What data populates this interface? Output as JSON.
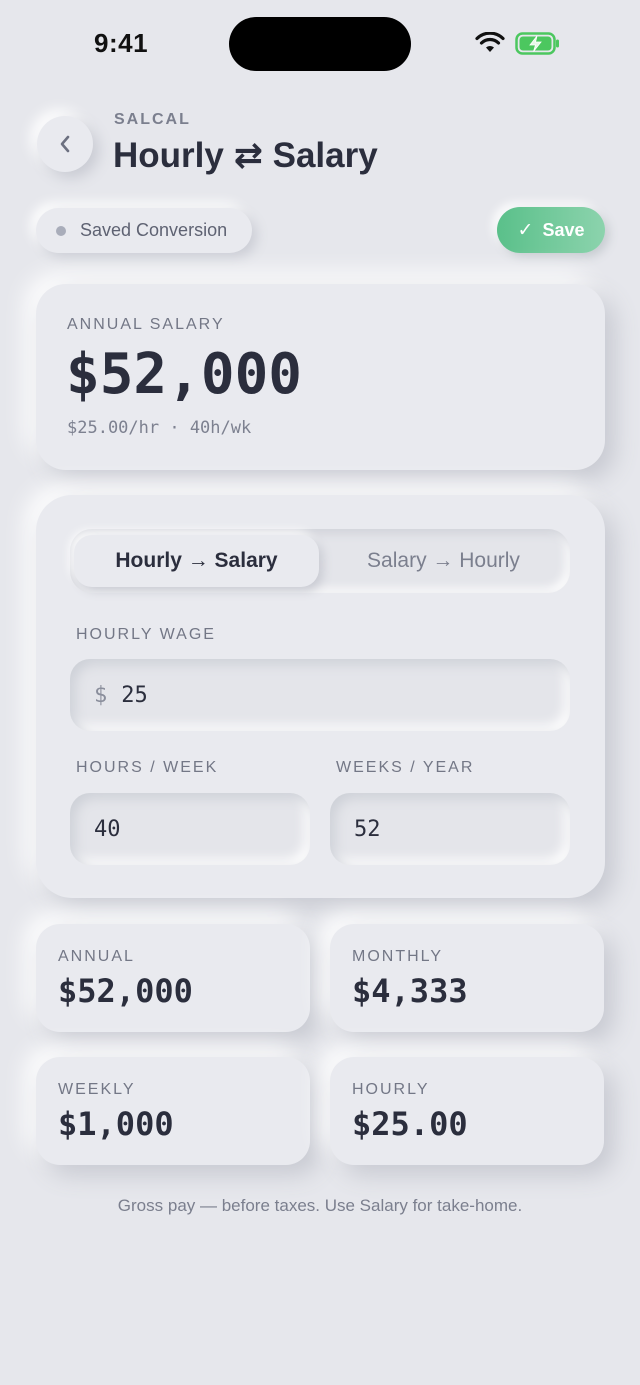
{
  "status_bar": {
    "time": "9:41"
  },
  "header": {
    "eyebrow": "SALCAL",
    "title": "Hourly ⇄ Salary",
    "back_icon": "chevron-left-icon"
  },
  "saved_pill": {
    "label": "Saved Conversion"
  },
  "save_button": {
    "label": "Save",
    "icon": "check-icon"
  },
  "hero": {
    "label": "ANNUAL SALARY",
    "value": "$52,000",
    "subtitle": "$25.00/hr · 40h/wk"
  },
  "mode_toggle": {
    "options": [
      "Hourly → Salary",
      "Salary → Hourly"
    ],
    "selected": "Hourly → Salary"
  },
  "inputs": {
    "hourly_wage": {
      "label": "HOURLY WAGE",
      "currency": "$",
      "value": "25"
    },
    "hours_per_week": {
      "label": "HOURS / WEEK",
      "value": "40"
    },
    "weeks_per_year": {
      "label": "WEEKS / YEAR",
      "value": "52"
    }
  },
  "results": [
    {
      "label": "ANNUAL",
      "value": "$52,000"
    },
    {
      "label": "MONTHLY",
      "value": "$4,333"
    },
    {
      "label": "WEEKLY",
      "value": "$1,000"
    },
    {
      "label": "HOURLY",
      "value": "$25.00"
    }
  ],
  "footnote": "Gross pay — before taxes. Use Salary for take-home.",
  "colors": {
    "background": "#e6e7ec",
    "accent_green": "#5ac08a",
    "text_dark": "#2b2e3d",
    "text_muted": "#737786"
  }
}
